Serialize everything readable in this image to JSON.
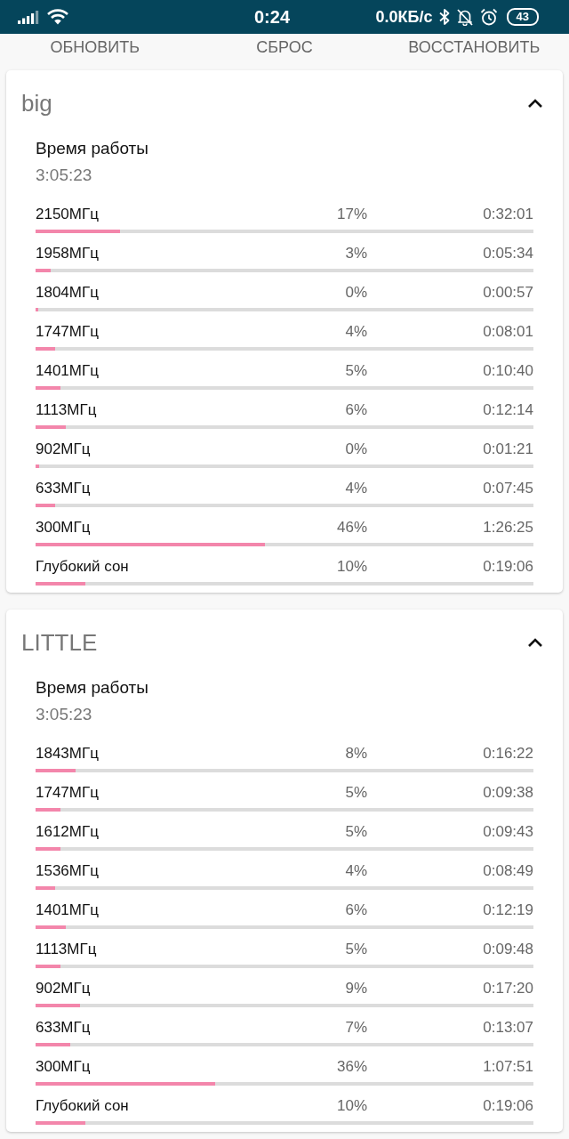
{
  "status_bar": {
    "time": "0:24",
    "network_speed": "0.0КБ/с",
    "battery": "43"
  },
  "toolbar": {
    "buttons": [
      "ОБНОВИТЬ",
      "СБРОС",
      "ВОССТАНОВИТЬ"
    ]
  },
  "clusters": [
    {
      "title": "big",
      "expanded": true,
      "uptime_label": "Время работы",
      "uptime": "3:05:23",
      "rows": [
        {
          "label": "2150МГц",
          "percent": "17%",
          "time": "0:32:01",
          "level": 0.17
        },
        {
          "label": "1958МГц",
          "percent": "3%",
          "time": "0:05:34",
          "level": 0.03
        },
        {
          "label": "1804МГц",
          "percent": "0%",
          "time": "0:00:57",
          "level": 0.005
        },
        {
          "label": "1747МГц",
          "percent": "4%",
          "time": "0:08:01",
          "level": 0.04
        },
        {
          "label": "1401МГц",
          "percent": "5%",
          "time": "0:10:40",
          "level": 0.05
        },
        {
          "label": "1113МГц",
          "percent": "6%",
          "time": "0:12:14",
          "level": 0.06
        },
        {
          "label": "902МГц",
          "percent": "0%",
          "time": "0:01:21",
          "level": 0.007
        },
        {
          "label": "633МГц",
          "percent": "4%",
          "time": "0:07:45",
          "level": 0.04
        },
        {
          "label": "300МГц",
          "percent": "46%",
          "time": "1:26:25",
          "level": 0.46
        },
        {
          "label": "Глубокий сон",
          "percent": "10%",
          "time": "0:19:06",
          "level": 0.1
        }
      ]
    },
    {
      "title": "LITTLE",
      "expanded": true,
      "uptime_label": "Время работы",
      "uptime": "3:05:23",
      "rows": [
        {
          "label": "1843МГц",
          "percent": "8%",
          "time": "0:16:22",
          "level": 0.08
        },
        {
          "label": "1747МГц",
          "percent": "5%",
          "time": "0:09:38",
          "level": 0.05
        },
        {
          "label": "1612МГц",
          "percent": "5%",
          "time": "0:09:43",
          "level": 0.05
        },
        {
          "label": "1536МГц",
          "percent": "4%",
          "time": "0:08:49",
          "level": 0.04
        },
        {
          "label": "1401МГц",
          "percent": "6%",
          "time": "0:12:19",
          "level": 0.06
        },
        {
          "label": "1113МГц",
          "percent": "5%",
          "time": "0:09:48",
          "level": 0.05
        },
        {
          "label": "902МГц",
          "percent": "9%",
          "time": "0:17:20",
          "level": 0.09
        },
        {
          "label": "633МГц",
          "percent": "7%",
          "time": "0:13:07",
          "level": 0.07
        },
        {
          "label": "300МГц",
          "percent": "36%",
          "time": "1:07:51",
          "level": 0.36
        },
        {
          "label": "Глубокий сон",
          "percent": "10%",
          "time": "0:19:06",
          "level": 0.1
        }
      ]
    }
  ]
}
